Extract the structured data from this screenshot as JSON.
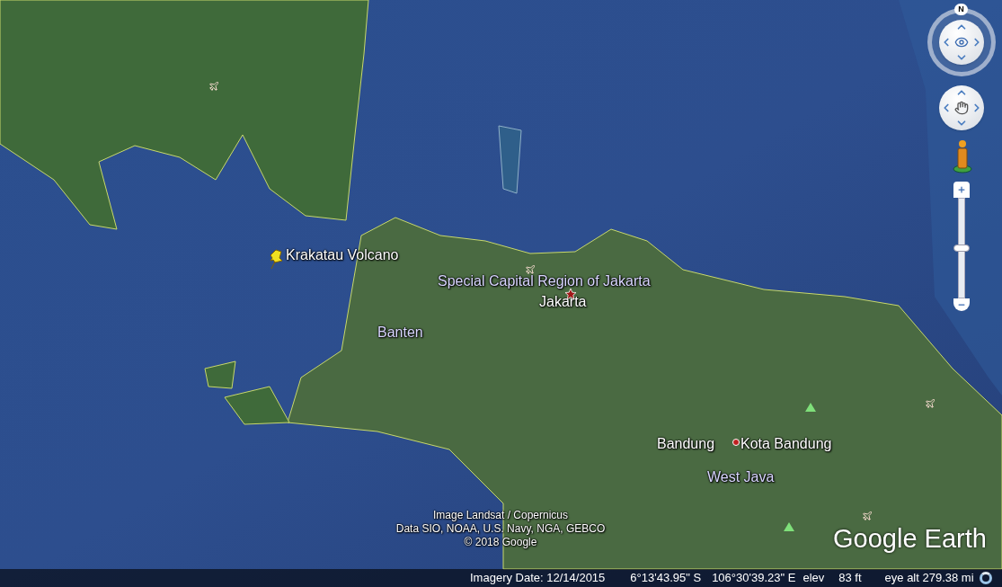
{
  "map_labels": [
    {
      "text": "Krakatau Volcano",
      "kind": "placemark"
    },
    {
      "text": "Special Capital Region of Jakarta",
      "kind": "region"
    },
    {
      "text": "Jakarta",
      "kind": "capital"
    },
    {
      "text": "Banten",
      "kind": "region"
    },
    {
      "text": "Bandung",
      "kind": "city"
    },
    {
      "text": "Kota Bandung",
      "kind": "city_dot"
    },
    {
      "text": "West Java",
      "kind": "region"
    }
  ],
  "attribution": [
    "Image Landsat / Copernicus",
    "Data SIO, NOAA, U.S. Navy, NGA, GEBCO",
    "© 2018 Google"
  ],
  "logo": "Google Earth",
  "navigation": {
    "north_label": "N",
    "zoom_slider": {
      "level": 0.5
    }
  },
  "status_bar": {
    "imagery_date": "Imagery Date: 12/14/2015",
    "latitude": "6°13'43.95\" S",
    "longitude": "106°30'39.23\" E",
    "elev_label": "elev",
    "elev_value": "83 ft",
    "eye_alt": "eye alt 279.38 mi"
  }
}
